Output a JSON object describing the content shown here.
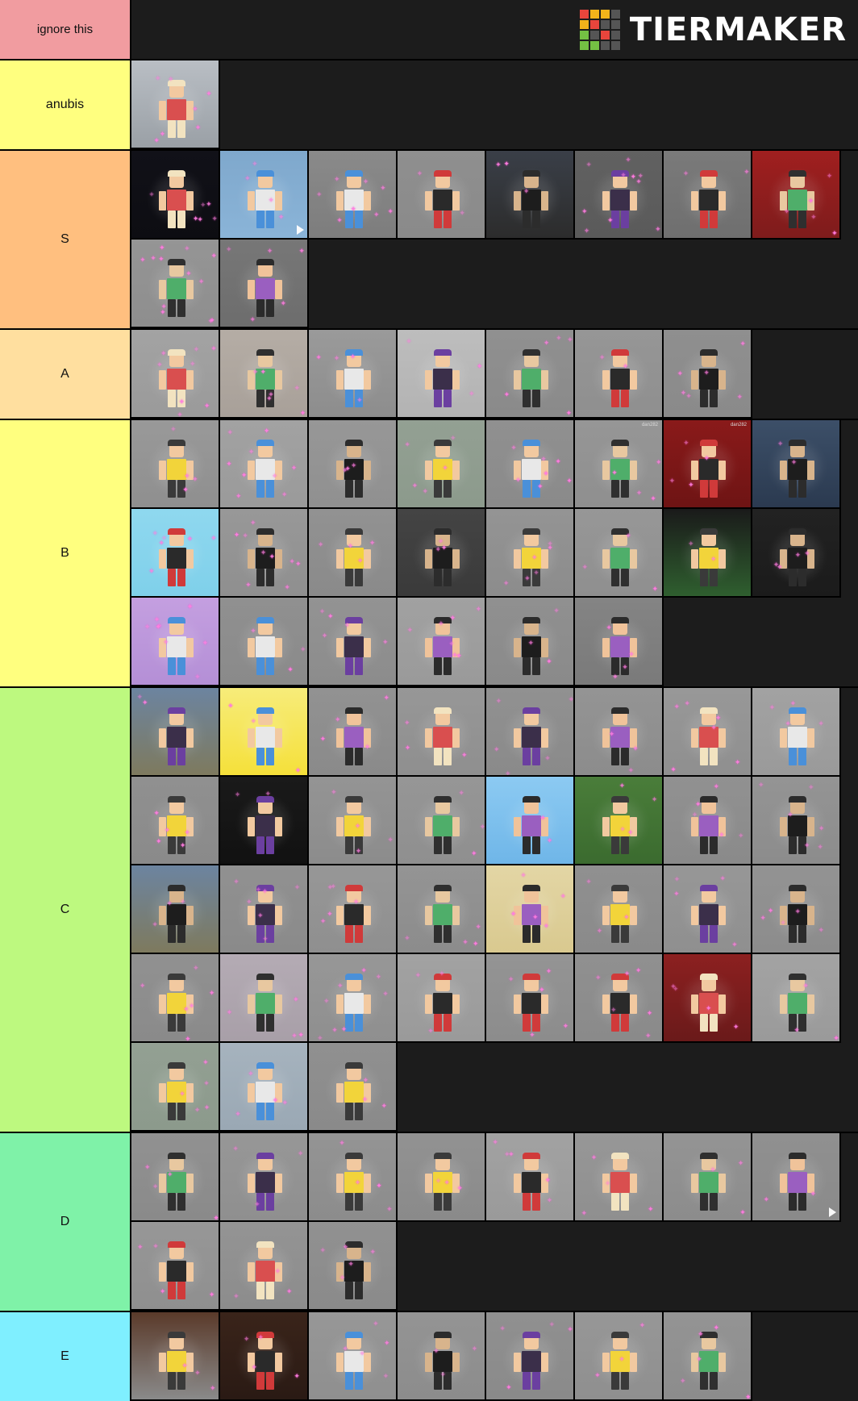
{
  "header": {
    "ignore_label": "ignore this",
    "brand_text": "TIERMAKER",
    "brand_colors": [
      "#e8453c",
      "#f2b31a",
      "#f2b31a",
      "#555555",
      "#f2b31a",
      "#e8453c",
      "#555555",
      "#555555",
      "#74c043",
      "#555555",
      "#e8453c",
      "#555555",
      "#74c043",
      "#74c043",
      "#555555",
      "#555555"
    ],
    "background": "#1c1c1c",
    "ignore_color": "#f19ca0"
  },
  "tiers": [
    {
      "label": "anubis",
      "color": "#ffff7f",
      "items": [
        {
          "name": "thumb-anubis-1",
          "bg": "#9aa0a6",
          "sky": "#b9bec4",
          "fig": "dark",
          "sparkles": 7
        }
      ]
    },
    {
      "label": "S",
      "color": "#ffbf7f",
      "items": [
        {
          "name": "thumb-s-1",
          "bg": "#0d0d12",
          "sky": "#111118",
          "fig": "void",
          "sparkles": 6
        },
        {
          "name": "thumb-s-2",
          "bg": "#8ab4d8",
          "sky": "#7fa8cc",
          "fig": "purple",
          "sparkles": 4,
          "play": true
        },
        {
          "name": "thumb-s-3",
          "bg": "#7d7d7d",
          "sky": "#8a8a8a",
          "fig": "greenorb",
          "sparkles": 8
        },
        {
          "name": "thumb-s-4",
          "bg": "#8a8a8a",
          "sky": "#8f8f8f",
          "fig": "tan-yellow",
          "sparkles": 2
        },
        {
          "name": "thumb-s-5",
          "bg": "#2c2c2c",
          "sky": "#3a3f48",
          "fig": "horse",
          "sparkles": 3
        },
        {
          "name": "thumb-s-6",
          "bg": "#5a5a5a",
          "sky": "#616161",
          "fig": "confetti-blue",
          "sparkles": 10
        },
        {
          "name": "thumb-s-7",
          "bg": "#6f6f6f",
          "sky": "#7a7a7a",
          "fig": "tiny-blue",
          "sparkles": 2
        },
        {
          "name": "thumb-s-8",
          "bg": "#7e1c1c",
          "sky": "#a01f1f",
          "fig": "red-beam",
          "sparkles": 5
        },
        {
          "name": "thumb-s-9",
          "bg": "#8e8e8e",
          "sky": "#959595",
          "fig": "confetti-pastel",
          "sparkles": 12
        },
        {
          "name": "thumb-s-10",
          "bg": "#6d6d6d",
          "sky": "#777777",
          "fig": "red-box",
          "sparkles": 5
        }
      ]
    },
    {
      "label": "A",
      "color": "#ffdf9f",
      "items": [
        {
          "name": "thumb-a-1",
          "bg": "#9a9a9a",
          "sky": "#a3a3a3",
          "fig": "red-white",
          "sparkles": 8
        },
        {
          "name": "thumb-a-2",
          "bg": "#a8a099",
          "sky": "#b5ada5",
          "fig": "maroon",
          "sparkles": 6
        },
        {
          "name": "thumb-a-3",
          "bg": "#8d8d8d",
          "sky": "#9a9a9a",
          "fig": "black-red",
          "sparkles": 4
        },
        {
          "name": "thumb-a-4",
          "bg": "#b3b3b3",
          "sky": "#bdbdbd",
          "fig": "tan-red",
          "sparkles": 3
        },
        {
          "name": "thumb-a-5",
          "bg": "#8a8a8a",
          "sky": "#909090",
          "fig": "cluster",
          "sparkles": 5
        },
        {
          "name": "thumb-a-6",
          "bg": "#8f8f8f",
          "sky": "#969696",
          "fig": "utensils",
          "sparkles": 2
        },
        {
          "name": "thumb-a-7",
          "bg": "#8a8a8a",
          "sky": "#8f8f8f",
          "fig": "yellow-hair",
          "sparkles": 6
        }
      ]
    },
    {
      "label": "B",
      "color": "#ffff7f",
      "items": [
        {
          "name": "thumb-b-1",
          "bg": "#8f8f8f",
          "sky": "#999999",
          "fig": "black-white",
          "sparkles": 4
        },
        {
          "name": "thumb-b-2",
          "bg": "#9a9a9a",
          "sky": "#a2a2a2",
          "fig": "rainbow",
          "sparkles": 9
        },
        {
          "name": "thumb-b-3",
          "bg": "#909090",
          "sky": "#979797",
          "fig": "white-flash",
          "sparkles": 3
        },
        {
          "name": "thumb-b-4",
          "bg": "#8c9a8c",
          "sky": "#93a093",
          "fig": "green-robot",
          "sparkles": 5
        },
        {
          "name": "thumb-b-5",
          "bg": "#8a8a8a",
          "sky": "#909090",
          "fig": "pink-hair",
          "sparkles": 7
        },
        {
          "name": "thumb-b-6",
          "bg": "#8f8f8f",
          "sky": "#969696",
          "fig": "skull",
          "sparkles": 4,
          "caption": "dan282"
        },
        {
          "name": "thumb-b-7",
          "bg": "#6e1414",
          "sky": "#8a1a1a",
          "fig": "red-demon",
          "sparkles": 4,
          "caption": "dan282"
        },
        {
          "name": "thumb-b-8",
          "bg": "#2b3a50",
          "sky": "#3c4f68",
          "fig": "blue-mech",
          "sparkles": 2
        },
        {
          "name": "thumb-b-9",
          "bg": "#7fd0ea",
          "sky": "#8fd8ef",
          "fig": "blue-pink",
          "sparkles": 6
        },
        {
          "name": "thumb-b-10",
          "bg": "#8f8f8f",
          "sky": "#989898",
          "fig": "white-ice",
          "sparkles": 9
        },
        {
          "name": "thumb-b-11",
          "bg": "#8a8a8a",
          "sky": "#929292",
          "fig": "red-yellow",
          "sparkles": 4
        },
        {
          "name": "thumb-b-12",
          "bg": "#3a3a3a",
          "sky": "#444444",
          "fig": "fire",
          "sparkles": 3
        },
        {
          "name": "thumb-b-13",
          "bg": "#8c8c8c",
          "sky": "#949494",
          "fig": "green-hood",
          "sparkles": 6
        },
        {
          "name": "thumb-b-14",
          "bg": "#8f8f8f",
          "sky": "#979797",
          "fig": "sword",
          "sparkles": 3
        },
        {
          "name": "thumb-b-15",
          "bg": "#2f5f2f",
          "sky": "#1a1a1a",
          "fig": "lightsaber",
          "sparkles": 2
        },
        {
          "name": "thumb-b-16",
          "bg": "#1b1b1b",
          "sky": "#222222",
          "fig": "piano",
          "sparkles": 4
        },
        {
          "name": "thumb-b-17",
          "bg": "#b48fd6",
          "sky": "#c49fe0",
          "fig": "purple-burst",
          "sparkles": 8
        },
        {
          "name": "thumb-b-18",
          "bg": "#8a8a8a",
          "sky": "#909090",
          "fig": "black-noob",
          "sparkles": 3
        },
        {
          "name": "thumb-b-19",
          "bg": "#8c8c8c",
          "sky": "#939393",
          "fig": "horn-red",
          "sparkles": 5
        },
        {
          "name": "thumb-b-20",
          "bg": "#9a9a9a",
          "sky": "#a1a1a1",
          "fig": "white-beast",
          "sparkles": 7
        },
        {
          "name": "thumb-b-21",
          "bg": "#8a8a8a",
          "sky": "#909090",
          "fig": "green-alien",
          "sparkles": 3
        },
        {
          "name": "thumb-b-22",
          "bg": "#7a7a7a",
          "sky": "#848484",
          "fig": "purple-dark",
          "sparkles": 4
        }
      ]
    },
    {
      "label": "C",
      "color": "#bdf97f",
      "items": [
        {
          "name": "thumb-c-1",
          "bg": "#7e7a5e",
          "sky": "#6c84a0",
          "fig": "field",
          "sparkles": 2
        },
        {
          "name": "thumb-c-2",
          "bg": "#f5e03a",
          "sky": "#f7ec7a",
          "fig": "yellow-beam",
          "sparkles": 3
        },
        {
          "name": "thumb-c-3",
          "bg": "#8a8a8a",
          "sky": "#929292",
          "fig": "block-blue",
          "sparkles": 4
        },
        {
          "name": "thumb-c-4",
          "bg": "#8f8f8f",
          "sky": "#979797",
          "fig": "purple-cape",
          "sparkles": 3
        },
        {
          "name": "thumb-c-5",
          "bg": "#8a8a8a",
          "sky": "#919191",
          "fig": "black-red-arm",
          "sparkles": 5
        },
        {
          "name": "thumb-c-6",
          "bg": "#8c8c8c",
          "sky": "#949494",
          "fig": "horn-purple",
          "sparkles": 3
        },
        {
          "name": "thumb-c-7",
          "bg": "#8f8f8f",
          "sky": "#989898",
          "fig": "blonde-white",
          "sparkles": 6
        },
        {
          "name": "thumb-c-8",
          "bg": "#9a9a9a",
          "sky": "#a2a2a2",
          "fig": "red-blocks",
          "sparkles": 4
        },
        {
          "name": "thumb-c-9",
          "bg": "#8a8a8a",
          "sky": "#909090",
          "fig": "green-purple",
          "sparkles": 5
        },
        {
          "name": "thumb-c-10",
          "bg": "#111111",
          "sky": "#1a1a1a",
          "fig": "black-beast",
          "sparkles": 2
        },
        {
          "name": "thumb-c-11",
          "bg": "#8c8c8c",
          "sky": "#949494",
          "fig": "horn-white",
          "sparkles": 4
        },
        {
          "name": "thumb-c-12",
          "bg": "#8f8f8f",
          "sky": "#969696",
          "fig": "horn-tan",
          "sparkles": 3
        },
        {
          "name": "thumb-c-13",
          "bg": "#6fb6e8",
          "sky": "#8ccaf2",
          "fig": "sky-car",
          "sparkles": 2
        },
        {
          "name": "thumb-c-14",
          "bg": "#3b6b2f",
          "sky": "#4a7d3a",
          "fig": "blue-noob",
          "sparkles": 4
        },
        {
          "name": "thumb-c-15",
          "bg": "#8a8a8a",
          "sky": "#919191",
          "fig": "steve",
          "sparkles": 5
        },
        {
          "name": "thumb-c-16",
          "bg": "#8c8c8c",
          "sky": "#949494",
          "fig": "creeper",
          "sparkles": 6
        },
        {
          "name": "thumb-c-17",
          "bg": "#7e7a5e",
          "sky": "#6c84a0",
          "fig": "field-blue",
          "sparkles": 3
        },
        {
          "name": "thumb-c-18",
          "bg": "#8a8a8a",
          "sky": "#919191",
          "fig": "cyan-glow",
          "sparkles": 7
        },
        {
          "name": "thumb-c-19",
          "bg": "#8f8f8f",
          "sky": "#979797",
          "fig": "red-clown",
          "sparkles": 5
        },
        {
          "name": "thumb-c-20",
          "bg": "#8c8c8c",
          "sky": "#949494",
          "fig": "panda-black",
          "sparkles": 4
        },
        {
          "name": "thumb-c-21",
          "bg": "#d9c98f",
          "sky": "#e3d6a5",
          "fig": "pink-pop",
          "sparkles": 5
        },
        {
          "name": "thumb-c-22",
          "bg": "#8a8a8a",
          "sky": "#909090",
          "fig": "pale-horn",
          "sparkles": 3
        },
        {
          "name": "thumb-c-23",
          "bg": "#8f8f8f",
          "sky": "#979797",
          "fig": "blue-shirt",
          "sparkles": 4
        },
        {
          "name": "thumb-c-24",
          "bg": "#8c8c8c",
          "sky": "#939393",
          "fig": "gold-yellow",
          "sparkles": 5
        },
        {
          "name": "thumb-c-25",
          "bg": "#8a8a8a",
          "sky": "#919191",
          "fig": "red-cap",
          "sparkles": 6
        },
        {
          "name": "thumb-c-26",
          "bg": "#a89fa8",
          "sky": "#b4abb4",
          "fig": "pink-green",
          "sparkles": 4
        },
        {
          "name": "thumb-c-27",
          "bg": "#8f8f8f",
          "sky": "#979797",
          "fig": "white-sparkle",
          "sparkles": 8
        },
        {
          "name": "thumb-c-28",
          "bg": "#9a9a9a",
          "sky": "#a2a2a2",
          "fig": "ufo",
          "sparkles": 3
        },
        {
          "name": "thumb-c-29",
          "bg": "#8c8c8c",
          "sky": "#949494",
          "fig": "pink-crystal",
          "sparkles": 5
        },
        {
          "name": "thumb-c-30",
          "bg": "#8a8a8a",
          "sky": "#909090",
          "fig": "green-neon",
          "sparkles": 6
        },
        {
          "name": "thumb-c-31",
          "bg": "#6a1a1a",
          "sky": "#8c2020",
          "fig": "red-glow",
          "sparkles": 4
        },
        {
          "name": "thumb-c-32",
          "bg": "#9a9a9a",
          "sky": "#a3a3a3",
          "fig": "white-silver",
          "sparkles": 3
        },
        {
          "name": "thumb-c-33",
          "bg": "#8c9a8c",
          "sky": "#93a093",
          "fig": "pink-green-2",
          "sparkles": 5
        },
        {
          "name": "thumb-c-34",
          "bg": "#9aa8b4",
          "sky": "#a6b3be",
          "fig": "pink-box",
          "sparkles": 4
        },
        {
          "name": "thumb-c-35",
          "bg": "#8a8a8a",
          "sky": "#909090",
          "fig": "red-dark",
          "sparkles": 3
        }
      ]
    },
    {
      "label": "D",
      "color": "#7ff2a8",
      "items": [
        {
          "name": "thumb-d-1",
          "bg": "#8a8a8a",
          "sky": "#919191",
          "fig": "red-shirt",
          "sparkles": 4
        },
        {
          "name": "thumb-d-2",
          "bg": "#8f8f8f",
          "sky": "#979797",
          "fig": "purple-sword",
          "sparkles": 3
        },
        {
          "name": "thumb-d-3",
          "bg": "#8c8c8c",
          "sky": "#949494",
          "fig": "yellow-outfit",
          "sparkles": 4
        },
        {
          "name": "thumb-d-4",
          "bg": "#8a8a8a",
          "sky": "#929292",
          "fig": "purple-horn",
          "sparkles": 3
        },
        {
          "name": "thumb-d-5",
          "bg": "#9a9a9a",
          "sky": "#a2a2a2",
          "fig": "white-hair",
          "sparkles": 5
        },
        {
          "name": "thumb-d-6",
          "bg": "#8f8f8f",
          "sky": "#979797",
          "fig": "white-cloud",
          "sparkles": 4
        },
        {
          "name": "thumb-d-7",
          "bg": "#8c8c8c",
          "sky": "#949494",
          "fig": "gold-purple",
          "sparkles": 3
        },
        {
          "name": "thumb-d-8",
          "bg": "#8a8a8a",
          "sky": "#909090",
          "fig": "red-stripe",
          "sparkles": 2,
          "play": true
        },
        {
          "name": "thumb-d-9",
          "bg": "#8f8f8f",
          "sky": "#979797",
          "fig": "gold-figure",
          "sparkles": 4
        },
        {
          "name": "thumb-d-10",
          "bg": "#8c8c8c",
          "sky": "#949494",
          "fig": "gold-frame",
          "sparkles": 3
        },
        {
          "name": "thumb-d-11",
          "bg": "#8a8a8a",
          "sky": "#919191",
          "fig": "gold-armor",
          "sparkles": 5
        }
      ]
    },
    {
      "label": "E",
      "color": "#7fefff",
      "items": [
        {
          "name": "thumb-e-1",
          "bg": "#8a8a8a",
          "sky": "#5a3a2a",
          "fig": "dark-room",
          "sparkles": 3
        },
        {
          "name": "thumb-e-2",
          "bg": "#2a1a14",
          "sky": "#3a241a",
          "fig": "red-brown",
          "sparkles": 4
        },
        {
          "name": "thumb-e-3",
          "bg": "#8f8f8f",
          "sky": "#979797",
          "fig": "pink-black",
          "sparkles": 5
        },
        {
          "name": "thumb-e-4",
          "bg": "#8c8c8c",
          "sky": "#949494",
          "fig": "balloon-gold",
          "sparkles": 3
        },
        {
          "name": "thumb-e-5",
          "bg": "#8a8a8a",
          "sky": "#909090",
          "fig": "blue-white-box",
          "sparkles": 4
        },
        {
          "name": "thumb-e-6",
          "bg": "#8f8f8f",
          "sky": "#979797",
          "fig": "purple-horn-2",
          "sparkles": 3
        },
        {
          "name": "thumb-e-7",
          "bg": "#8c8c8c",
          "sky": "#949494",
          "fig": "pink-purple",
          "sparkles": 5
        }
      ]
    }
  ]
}
